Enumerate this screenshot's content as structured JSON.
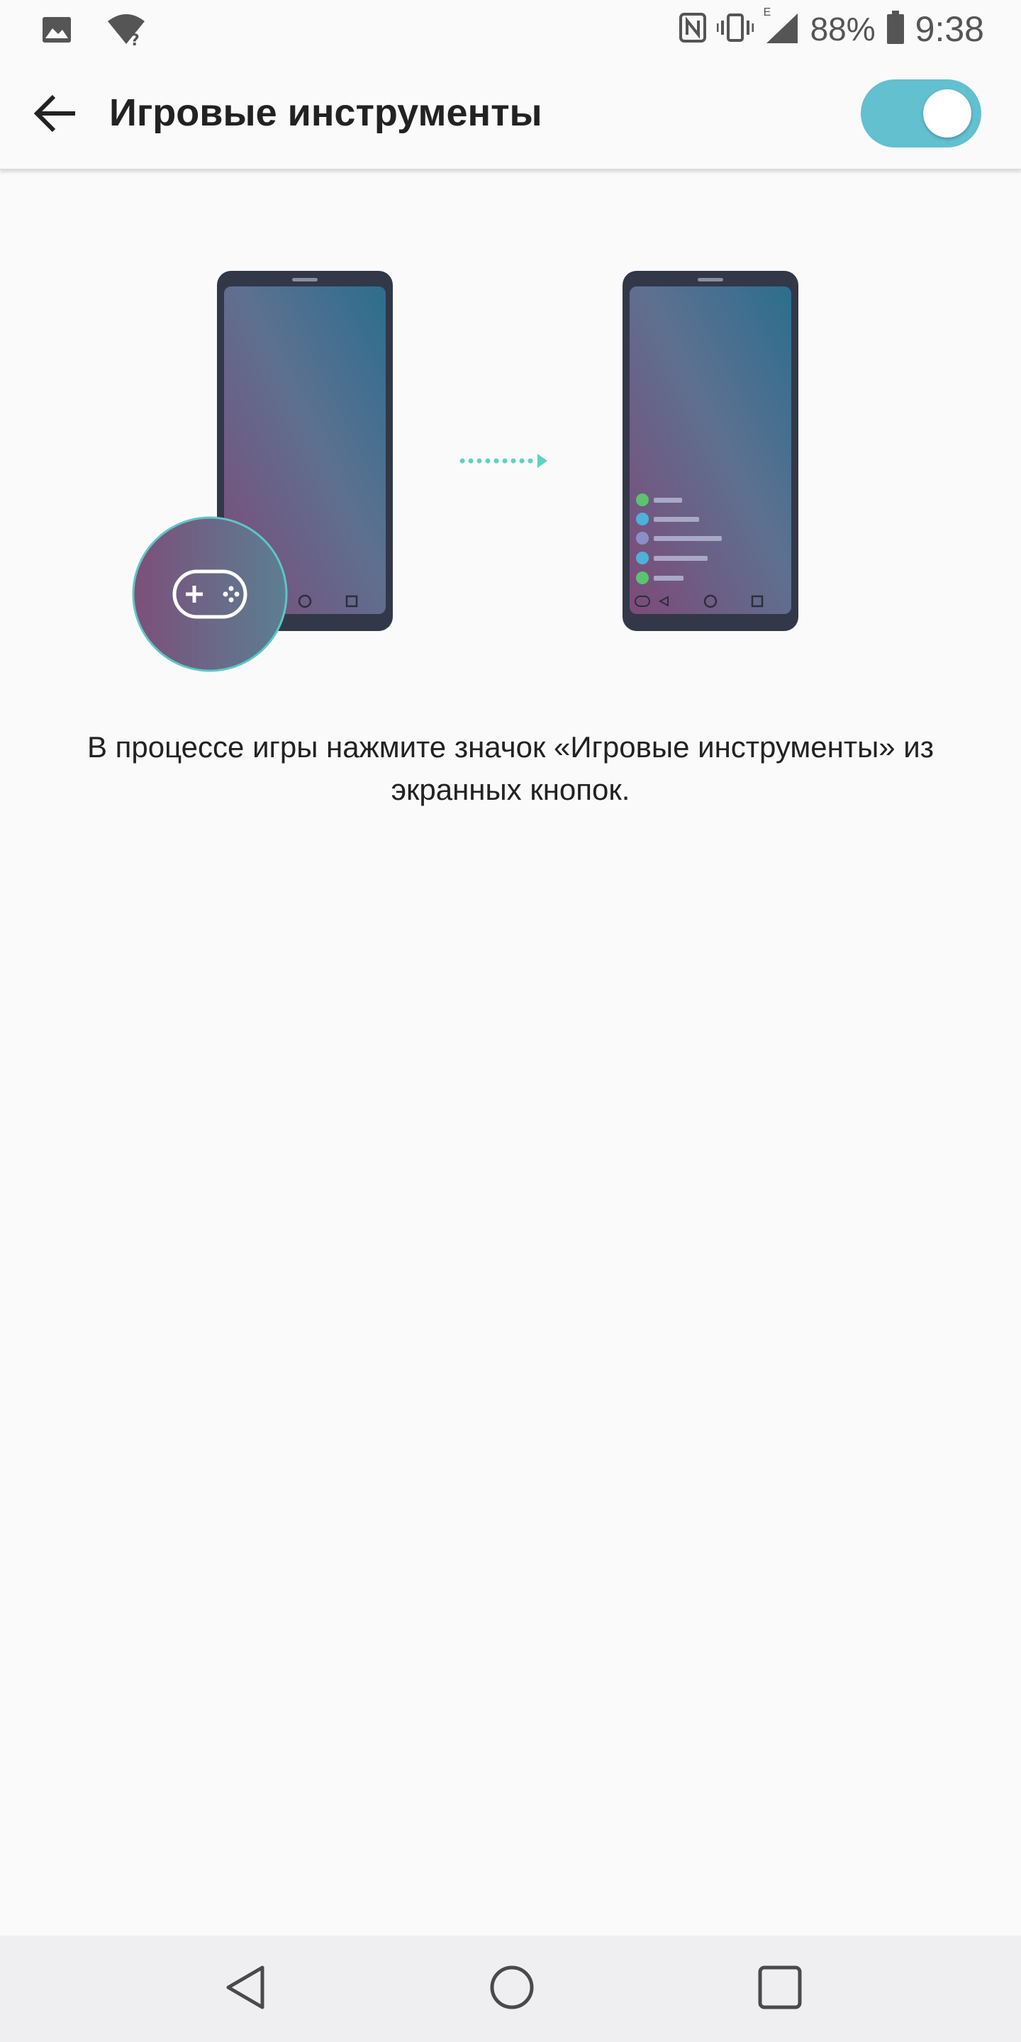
{
  "status_bar": {
    "battery_percent": "88%",
    "time": "9:38",
    "network_badge": "E",
    "icons": [
      "gallery-icon",
      "wifi-unknown-icon",
      "nfc-icon",
      "vibrate-icon",
      "signal-icon",
      "battery-icon"
    ]
  },
  "header": {
    "title": "Игровые инструменты",
    "toggle_on": true,
    "accent_color": "#62c0cf"
  },
  "illustration": {
    "left_phone_badge_icon": "gamepad-icon",
    "arrow_color": "#5dd3c2",
    "right_phone_menu_items": [
      {
        "color": "#5cc370"
      },
      {
        "color": "#4fb0d8"
      },
      {
        "color": "#8a8fc8"
      },
      {
        "color": "#4fb0d8"
      },
      {
        "color": "#5cc370"
      }
    ]
  },
  "main": {
    "description": "В процессе игры нажмите значок «Игровые инструменты» из экранных кнопок."
  },
  "nav_bar": {
    "buttons": [
      "back-triangle-icon",
      "home-circle-icon",
      "recents-square-icon"
    ]
  }
}
